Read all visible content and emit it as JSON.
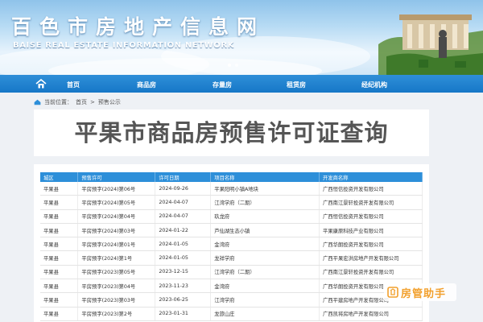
{
  "header": {
    "title": "百色市房地产信息网",
    "subtitle": "BAISE REAL ESTATE INFORMATION NETWORK",
    "carousel_dots": 2
  },
  "nav": {
    "items": [
      "首页",
      "商品房",
      "存量房",
      "租赁房",
      "经纪机构"
    ]
  },
  "breadcrumb": {
    "prefix": "当前位置：",
    "home": "首页",
    "sep": ">",
    "current": "预售公示"
  },
  "page": {
    "title": "平果市商品房预售许可证查询"
  },
  "table": {
    "headers": [
      "城区",
      "预售许可",
      "许可日期",
      "项目名称",
      "开发商名称"
    ],
    "rows": [
      [
        "平果县",
        "平房预字(2024)第06号",
        "2024-09-26",
        "平果阳明小镇A地块",
        "广西恒信投资开发有限公司"
      ],
      [
        "平果县",
        "平房预字(2024)第05号",
        "2024-04-07",
        "江湾学府（二期）",
        "广西南江景轩投资开发有限公司"
      ],
      [
        "平果县",
        "平房预字(2024)第04号",
        "2024-04-07",
        "玖龙府",
        "广西恒信投资开发有限公司"
      ],
      [
        "平果县",
        "平房预字(2024)第03号",
        "2024-01-22",
        "芦仙湖生态小镇",
        "平果康原科技产业有限公司"
      ],
      [
        "平果县",
        "平房预字(2024)第01号",
        "2024-01-05",
        "金湾府",
        "广西华朗投资开发有限公司"
      ],
      [
        "平果县",
        "平房预字(2024)第1号",
        "2024-01-05",
        "龙祥学府",
        "广西平果宏洪房地产开发有限公司"
      ],
      [
        "平果县",
        "平房预字(2023)第05号",
        "2023-12-15",
        "江湾学府（二期）",
        "广西南江景轩投资开发有限公司"
      ],
      [
        "平果县",
        "平房预字(2023)第04号",
        "2023-11-23",
        "金湾府",
        "广西华朗投资开发有限公司"
      ],
      [
        "平果县",
        "平房预字(2023)第03号",
        "2023-06-25",
        "江湾学府",
        "广西平建房地产开发有限公司"
      ],
      [
        "平果县",
        "平房预字(2023)第2号",
        "2023-01-31",
        "龙旅山庄",
        "广西凯将房地产开发有限公司"
      ]
    ]
  },
  "watermark": {
    "text": "房管助手"
  },
  "colors": {
    "nav_bg": "#1677c7",
    "table_header": "#2d8fd9",
    "watermark": "#f2a02d"
  }
}
